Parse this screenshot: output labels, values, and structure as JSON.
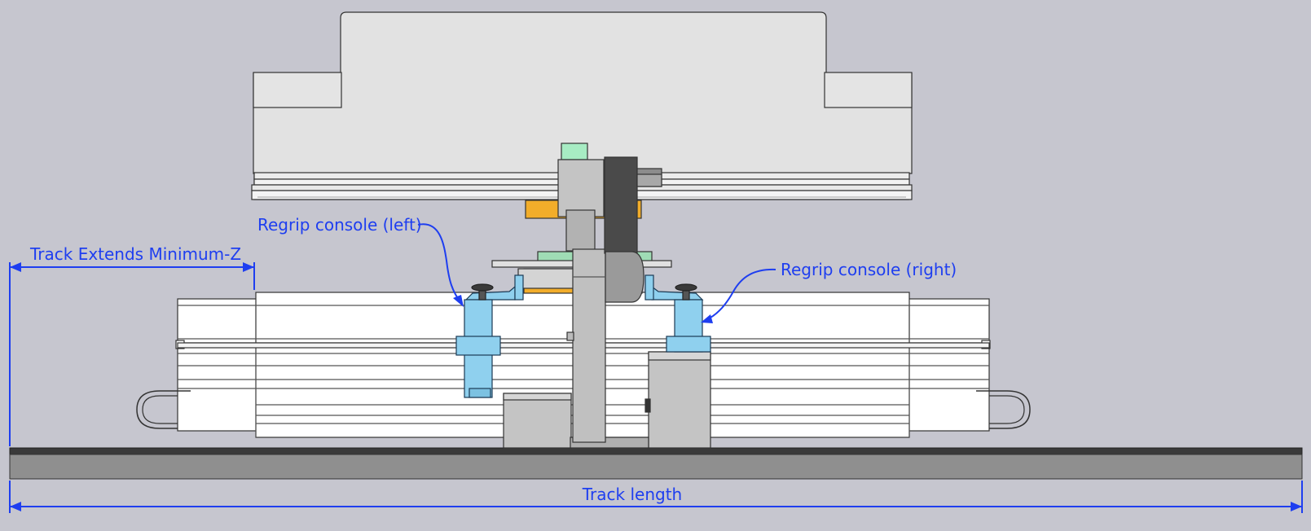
{
  "annotations": {
    "track_extends": "Track Extends Minimum-Z",
    "regrip_left": "Regrip console (left)",
    "regrip_right": "Regrip console (right)",
    "track_length": "Track length"
  },
  "colors": {
    "background": "#c6c6cf",
    "annotation_blue": "#1e3ef0",
    "console_blue": "#8fd0ee",
    "gripper_orange": "#f2ad2a",
    "sensor_green": "#a7ecc3",
    "rail_dark": "#3a3a3a",
    "rail_gray": "#8f8f8f",
    "housing_light": "#e2e2e2",
    "frame_white": "#ffffff",
    "column_gray": "#bcbcbc",
    "column_dark": "#4a4a4a"
  }
}
